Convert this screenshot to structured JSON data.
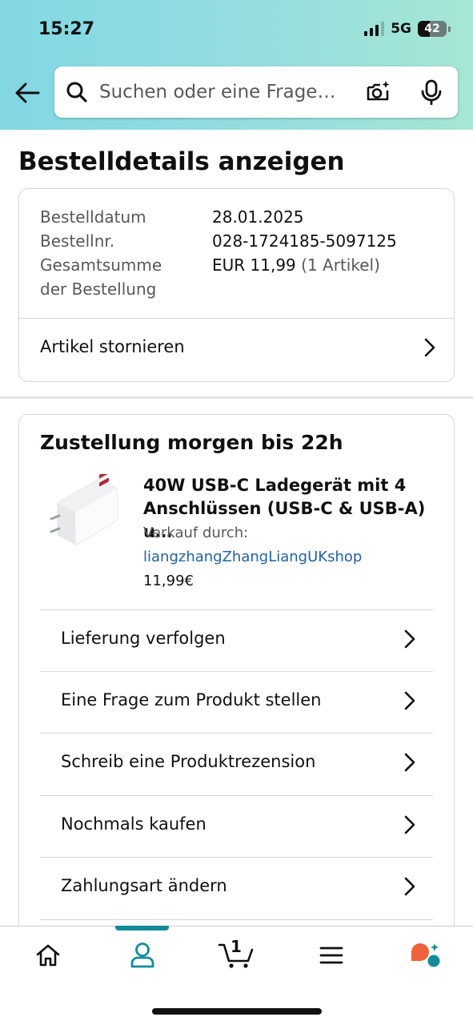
{
  "status_bar": {
    "time": "15:27",
    "network": "5G",
    "battery": "42"
  },
  "search": {
    "placeholder": "Suchen oder eine Frage…"
  },
  "page": {
    "title": "Bestelldetails anzeigen"
  },
  "order_summary": {
    "date_label": "Bestelldatum",
    "date_value": "28.01.2025",
    "number_label": "Bestellnr.",
    "number_value": "028-1724185-5097125",
    "total_label_line1": "Gesamtsumme",
    "total_label_line2": "der Bestellung",
    "total_value": "EUR 11,99",
    "total_items": "(1 Artikel)",
    "cancel_label": "Artikel stornieren"
  },
  "shipment": {
    "title": "Zustellung morgen bis 22h",
    "product_name": "40W USB-C Ladegerät mit 4 Anschlüssen (USB-C & USB-A) u…",
    "sold_by_label": "Verkauf durch:",
    "seller": "liangzhangZhangLiangUKshop",
    "price": "11,99€",
    "actions": [
      {
        "label": "Lieferung verfolgen"
      },
      {
        "label": "Eine Frage zum Produkt stellen"
      },
      {
        "label": "Schreib eine Produktrezension"
      },
      {
        "label": "Nochmals kaufen"
      },
      {
        "label": "Zahlungsart ändern"
      }
    ]
  },
  "bottom_nav": {
    "items": [
      "home-icon",
      "account-icon",
      "cart-icon",
      "menu-icon",
      "rufus-icon"
    ],
    "active": "account-icon",
    "cart_count": "1",
    "accent_color": "#138b9a"
  }
}
